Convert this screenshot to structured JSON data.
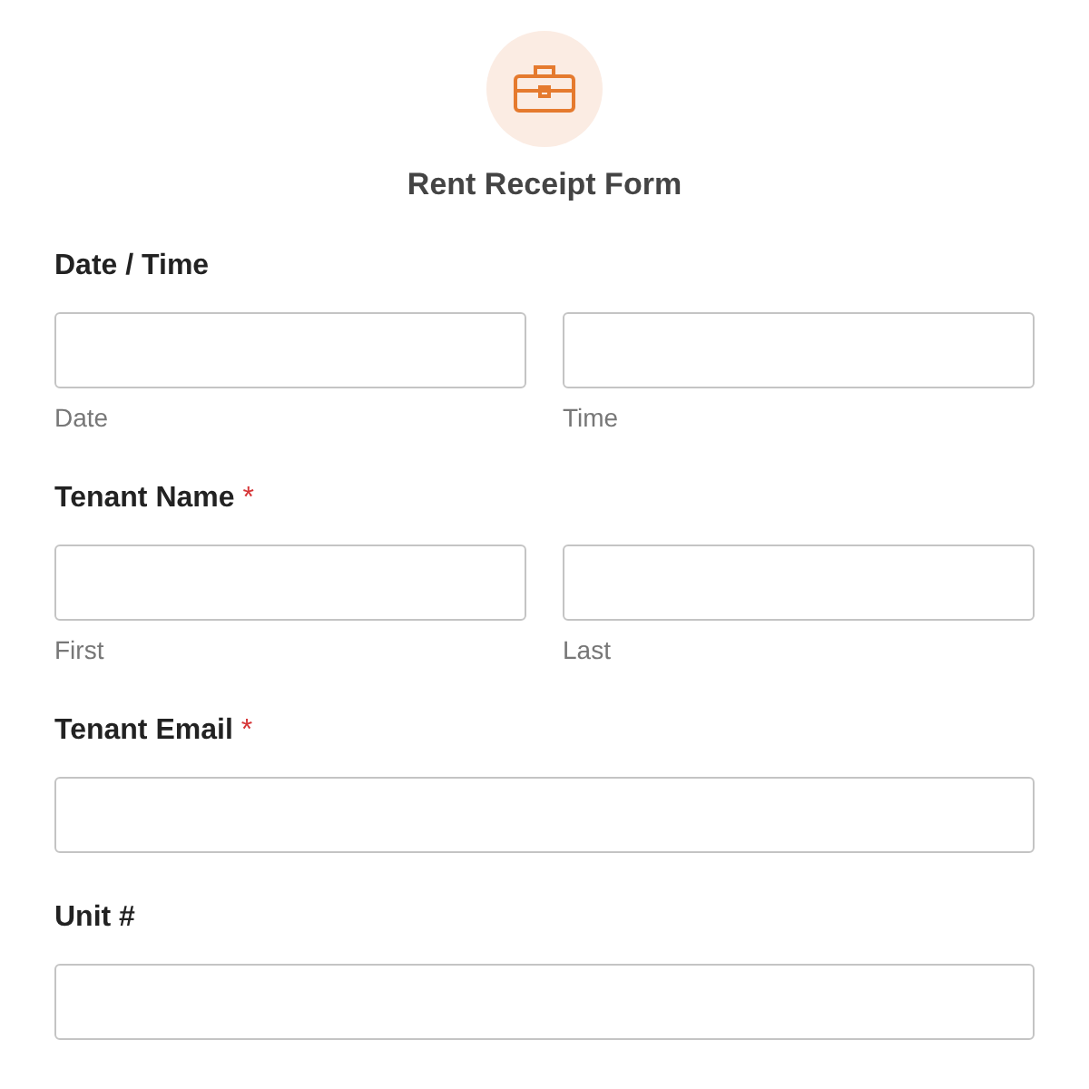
{
  "form": {
    "title": "Rent Receipt Form"
  },
  "fields": [
    {
      "label": "Date / Time",
      "sublabels": [
        "Date",
        "Time"
      ]
    },
    {
      "label": "Tenant Name",
      "required_mark": "*",
      "sublabels": [
        "First",
        "Last"
      ]
    },
    {
      "label": "Tenant Email",
      "required_mark": "*"
    },
    {
      "label": "Unit #"
    }
  ]
}
